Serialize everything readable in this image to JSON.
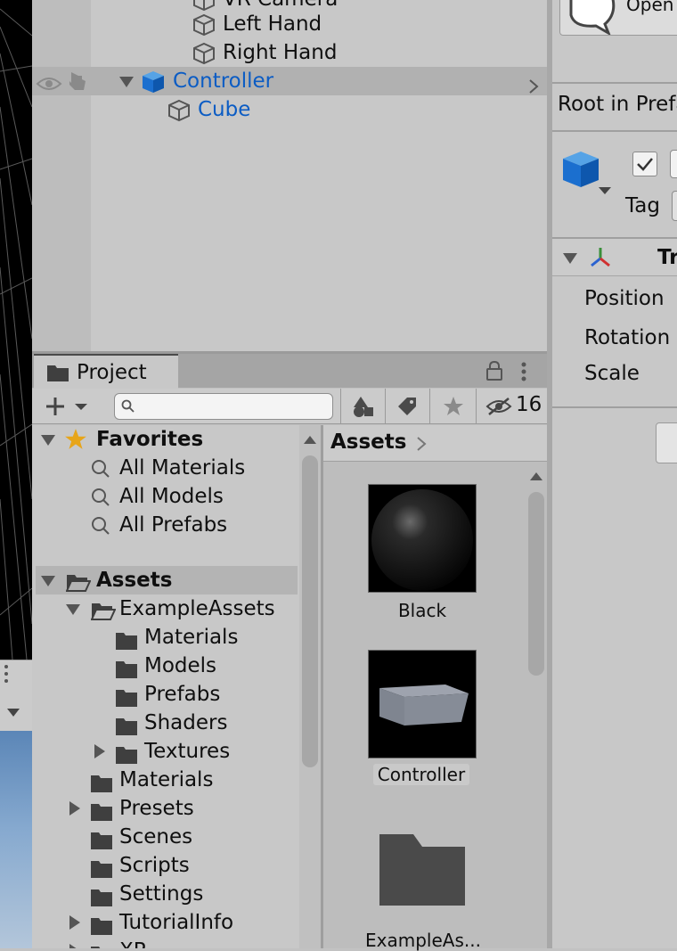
{
  "hierarchy": {
    "items": [
      {
        "label": "VR Camera"
      },
      {
        "label": "Left Hand"
      },
      {
        "label": "Right Hand"
      },
      {
        "label": "Controller"
      },
      {
        "label": "Cube"
      }
    ]
  },
  "project": {
    "tab_label": "Project",
    "hidden_count": "16",
    "search": {
      "value": "",
      "placeholder": ""
    },
    "breadcrumb": "Assets",
    "tree": {
      "favorites_label": "Favorites",
      "favorites": [
        "All Materials",
        "All Models",
        "All Prefabs"
      ],
      "assets_label": "Assets",
      "example_assets_label": "ExampleAssets",
      "example_children": [
        "Materials",
        "Models",
        "Prefabs",
        "Shaders",
        "Textures"
      ],
      "asset_children": [
        "Materials",
        "Presets",
        "Scenes",
        "Scripts",
        "Settings",
        "TutorialInfo",
        "XR"
      ]
    },
    "grid_items": [
      {
        "label": "Black"
      },
      {
        "label": "Controller"
      },
      {
        "label": "ExampleAs..."
      }
    ]
  },
  "inspector": {
    "open_label": "Open",
    "root_label": "Root in Prefa",
    "tag_label": "Tag",
    "transform_label": "Tr",
    "position_label": "Position",
    "rotation_label": "Rotation",
    "scale_label": "Scale"
  },
  "colors": {
    "selection_text": "#0b5cc4",
    "panel_bg": "#c8c8c8",
    "favorites_star": "#e7a51a"
  }
}
